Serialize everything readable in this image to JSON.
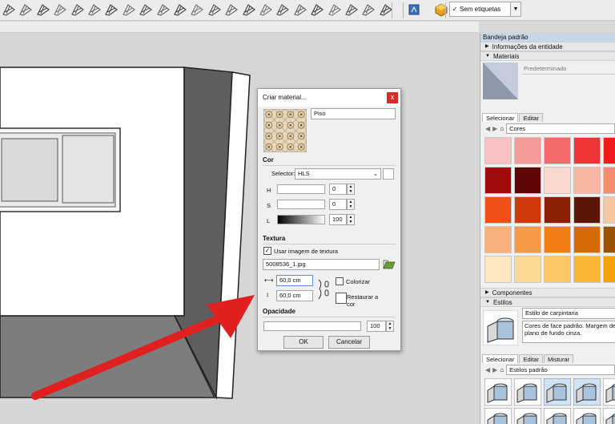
{
  "toolbar": {
    "icons": [
      "line-tool-icon",
      "arc-tool-icon",
      "freehand-tool-icon",
      "shape-tool-icon",
      "push-pull-icon",
      "offset-icon",
      "follow-me-icon",
      "rotate-icon",
      "move-icon",
      "scale-icon",
      "tape-icon",
      "dimension-icon",
      "protractor-icon",
      "text-icon",
      "axes-icon",
      "3d-text-icon",
      "orbit-icon",
      "pan-icon",
      "zoom-icon",
      "zoom-extents-icon",
      "walk-icon",
      "look-around-icon",
      "section-icon",
      "warehouse-icon",
      "extension-icon",
      "materials-icon",
      "components-icon"
    ],
    "tags_select": {
      "check": "✓",
      "value": "Sem etiquetas"
    }
  },
  "tray": {
    "title": "Bandeja padrão",
    "entity_info": "Informações da entidade",
    "materials": {
      "header": "Materiais",
      "default_name": "Predeterminado",
      "tabs": [
        "Selecionar",
        "Editar"
      ],
      "collection": "Cores",
      "swatches": [
        "#f9c2c2",
        "#f59a9a",
        "#f46a6a",
        "#ee3434",
        "#f01c1c",
        "#a00b0b",
        "#5e0606",
        "#fbd8cf",
        "#f9b7a3",
        "#f48c70",
        "#f04f16",
        "#cf3a0a",
        "#8c2004",
        "#5c1605",
        "#f6c6a0",
        "#f9b07a",
        "#f79a46",
        "#f27d12",
        "#d56b05",
        "#9c5204",
        "#fde8c2",
        "#fcd894",
        "#fcc764",
        "#fbb534",
        "#f5a30c"
      ]
    },
    "components_header": "Componentes",
    "styles": {
      "header": "Estilos",
      "style_name": "Estilo de carpintaria",
      "description": "Cores de face padrão. Margem de plano de fundo cinza.",
      "tabs": [
        "Selecionar",
        "Editar",
        "Misturar"
      ],
      "collection": "Estilos padrão"
    }
  },
  "dialog": {
    "title": "Criar material...",
    "close": "x",
    "name": "Piso",
    "color_header": "Cor",
    "picker_label": "Selector:",
    "picker_value": "HLS",
    "h_label": "H",
    "h_value": "0",
    "s_label": "S",
    "s_value": "0",
    "l_label": "L",
    "l_value": "100",
    "texture_header": "Textura",
    "use_texture_label": "Usar imagem de textura",
    "use_texture_checked": "✓",
    "texture_file": "5008536_1.jpg",
    "width_value": "60,0 cm",
    "height_value": "60,0 cm",
    "colorize_label": "Colorizar",
    "restore_label": "Restaurar a cor",
    "opacity_header": "Opacidade",
    "opacity_value": "100",
    "ok_label": "OK",
    "cancel_label": "Cancelar"
  }
}
